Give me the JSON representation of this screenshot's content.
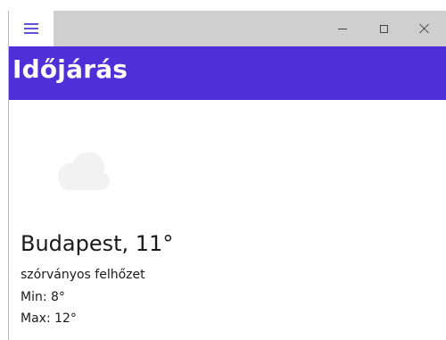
{
  "titlebar": {
    "menu_icon": "hamburger-icon",
    "minimize_icon": "minimize-icon",
    "maximize_icon": "maximize-icon",
    "close_icon": "close-icon"
  },
  "header": {
    "title": "Időjárás",
    "background_color": "#4f2fd8"
  },
  "weather": {
    "icon": "cloud-icon",
    "city_temp": "Budapest, 11°",
    "description": "szórványos felhőzet",
    "min": "Min: 8°",
    "max": "Max: 12°"
  }
}
